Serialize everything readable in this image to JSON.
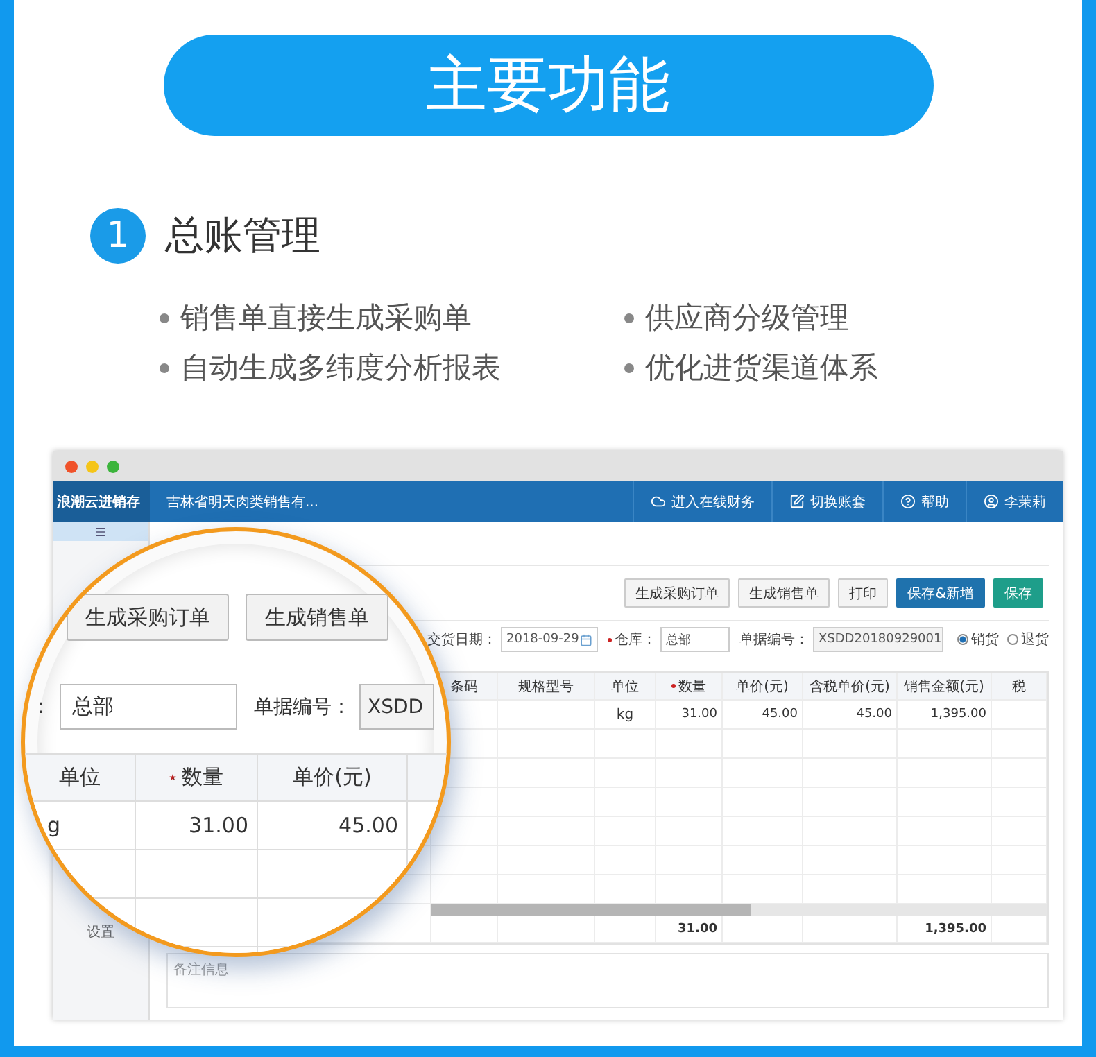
{
  "banner": {
    "title": "主要功能"
  },
  "section": {
    "number": "1",
    "title": "总账管理",
    "features": [
      "销售单直接生成采购单",
      "供应商分级管理",
      "自动生成多纬度分析报表",
      "优化进货渠道体系"
    ]
  },
  "app": {
    "brand": "浪潮云进销存",
    "company": "吉林省明天肉类销售有...",
    "nav": [
      {
        "label": "进入在线财务",
        "kind": "cloud"
      },
      {
        "label": "切换账套",
        "kind": "edit"
      },
      {
        "label": "帮助",
        "kind": "help"
      },
      {
        "label": "李茉莉",
        "kind": "user"
      }
    ],
    "sidebar": {
      "items": [
        "设置"
      ]
    },
    "toolbar": [
      {
        "label": "生成采购订单",
        "kind": "default"
      },
      {
        "label": "生成销售单",
        "kind": "default"
      },
      {
        "label": "打印",
        "kind": "default"
      },
      {
        "label": "保存&新增",
        "kind": "primary"
      },
      {
        "label": "保存",
        "kind": "success"
      }
    ],
    "form": {
      "date_label": "交货日期：",
      "date": "2018-09-29",
      "warehouse_label": "仓库：",
      "warehouse": "总部",
      "number_label": "单据编号：",
      "number": "XSDD20180929001",
      "radios": [
        {
          "label": "销货",
          "selected": true
        },
        {
          "label": "退货",
          "selected": false
        }
      ]
    },
    "table": {
      "columns": [
        {
          "label": "条码",
          "required": false
        },
        {
          "label": "规格型号",
          "required": false
        },
        {
          "label": "单位",
          "required": false
        },
        {
          "label": "数量",
          "required": true
        },
        {
          "label": "单价(元)",
          "required": false
        },
        {
          "label": "含税单价(元)",
          "required": false
        },
        {
          "label": "销售金额(元)",
          "required": false
        },
        {
          "label": "税",
          "required": false
        }
      ],
      "rows": [
        [
          "",
          "",
          "kg",
          "31.00",
          "45.00",
          "45.00",
          "1,395.00",
          ""
        ]
      ],
      "totals": {
        "quantity": "31.00",
        "amount": "1,395.00"
      }
    },
    "notes": {
      "placeholder": "备注信息"
    }
  },
  "magnifier": {
    "buttons": [
      "生成采购订单",
      "生成销售单"
    ],
    "warehouse_label": "：",
    "warehouse": "总部",
    "number_label": "单据编号：",
    "number": "XSDD",
    "columns": [
      {
        "label": "单位",
        "required": false
      },
      {
        "label": "数量",
        "required": true
      },
      {
        "label": "单价(元)",
        "required": false
      }
    ],
    "rows": [
      [
        "g",
        "31.00",
        "45.00"
      ]
    ]
  }
}
